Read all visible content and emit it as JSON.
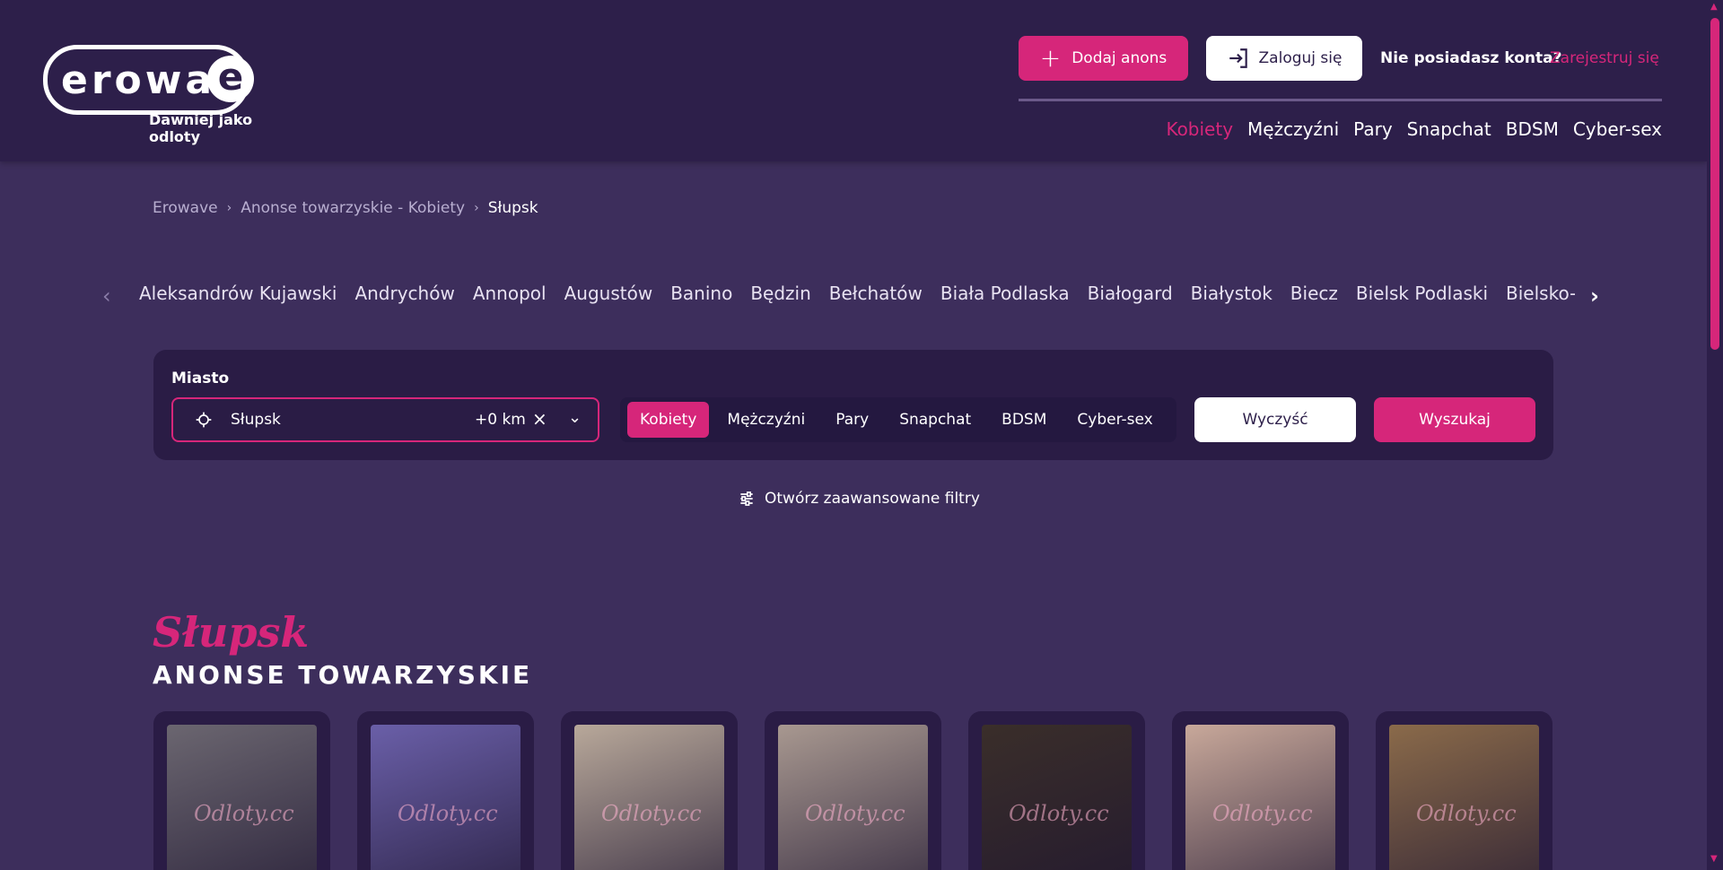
{
  "header": {
    "logo_text": "erowav",
    "logo_e": "e",
    "logo_sub": "Dawniej jako odloty",
    "add_button": "Dodaj anons",
    "login_button": "Zaloguj się",
    "no_account": "Nie posiadasz konta?",
    "register_link": "Zarejestruj się",
    "nav": [
      {
        "label": "Kobiety",
        "active": true
      },
      {
        "label": "Mężczyźni"
      },
      {
        "label": "Pary"
      },
      {
        "label": "Snapchat"
      },
      {
        "label": "BDSM"
      },
      {
        "label": "Cyber-sex"
      }
    ]
  },
  "breadcrumb": {
    "items": [
      "Erowave",
      "Anonse towarzyskie - Kobiety",
      "Słupsk"
    ]
  },
  "cities": [
    "Aleksandrów Kujawski",
    "Andrychów",
    "Annopol",
    "Augustów",
    "Banino",
    "Będzin",
    "Bełchatów",
    "Biała Podlaska",
    "Białogard",
    "Białystok",
    "Biecz",
    "Bielsk Podlaski",
    "Bielsko-Biała"
  ],
  "search": {
    "label": "Miasto",
    "city_value": "Słupsk",
    "distance": "+0 km",
    "categories": [
      {
        "label": "Kobiety",
        "active": true
      },
      {
        "label": "Mężczyźni"
      },
      {
        "label": "Pary"
      },
      {
        "label": "Snapchat"
      },
      {
        "label": "BDSM"
      },
      {
        "label": "Cyber-sex"
      }
    ],
    "clear_button": "Wyczyść",
    "search_button": "Wyszukaj"
  },
  "advanced_filters": "Otwórz zaawansowane filtry",
  "title": {
    "city": "Słupsk",
    "section": "ANONSE TOWARZYSKIE"
  },
  "cards": [
    {
      "watermark": "Odloty.cc",
      "tone": "#6b6670"
    },
    {
      "watermark": "Odloty.cc",
      "tone": "#6a5fa8"
    },
    {
      "watermark": "Odloty.cc",
      "tone": "#b8a89a"
    },
    {
      "watermark": "Odloty.cc",
      "tone": "#a89890"
    },
    {
      "watermark": "Odloty.cc",
      "tone": "#3a2e2a"
    },
    {
      "watermark": "Odloty.cc",
      "tone": "#c8a89a"
    },
    {
      "watermark": "Odloty.cc",
      "tone": "#8a6a4a"
    }
  ],
  "colors": {
    "accent": "#d6267a",
    "background": "#3d2e5c",
    "header_bg": "#2d1f4a",
    "panel_bg": "#2a1c45"
  }
}
